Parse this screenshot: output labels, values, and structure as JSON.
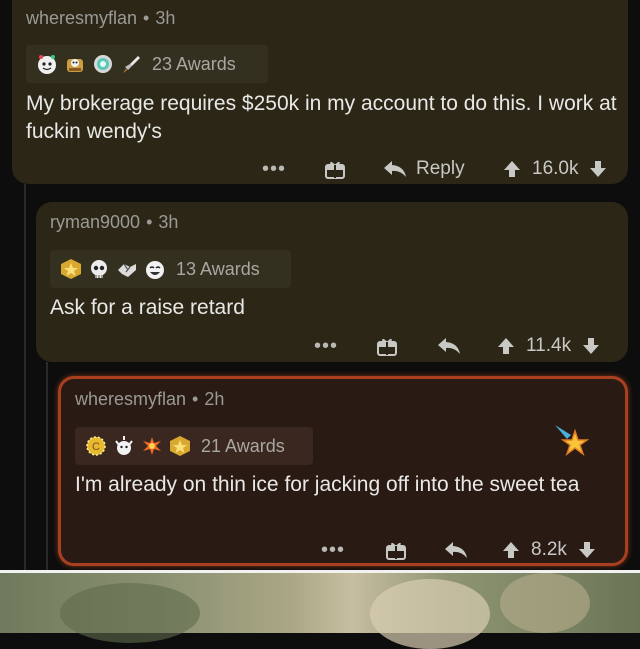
{
  "comments": [
    {
      "username": "wheresmyflan",
      "age": "3h",
      "awards_label": "23 Awards",
      "award_icons": [
        "snoo-award-icon",
        "gold-bag-award-icon",
        "silver-medal-award-icon",
        "rocket-award-icon"
      ],
      "body": "My brokerage requires $250k in my account to do this. I work at fuckin wendy's",
      "more": "•••",
      "reply_label": "Reply",
      "score": "16.0k"
    },
    {
      "username": "ryman9000",
      "age": "3h",
      "awards_label": "13 Awards",
      "award_icons": [
        "gold-star-award-icon",
        "skull-award-icon",
        "handshake-award-icon",
        "laughing-award-icon"
      ],
      "body": "Ask for a raise retard",
      "more": "•••",
      "score": "11.4k"
    },
    {
      "username": "wheresmyflan",
      "age": "2h",
      "awards_label": "21 Awards",
      "award_icons": [
        "gold-coin-award-icon",
        "cheer-award-icon",
        "star-burst-award-icon",
        "gold-star-award-icon"
      ],
      "body": "I'm already on thin ice for jacking off into the sweet tea",
      "more": "•••",
      "score": "8.2k"
    }
  ],
  "colors": {
    "card_bg": "#2b2616",
    "highlight_border": "#a8401f",
    "text": "#e8e8e6",
    "meta": "#9a9a96"
  }
}
